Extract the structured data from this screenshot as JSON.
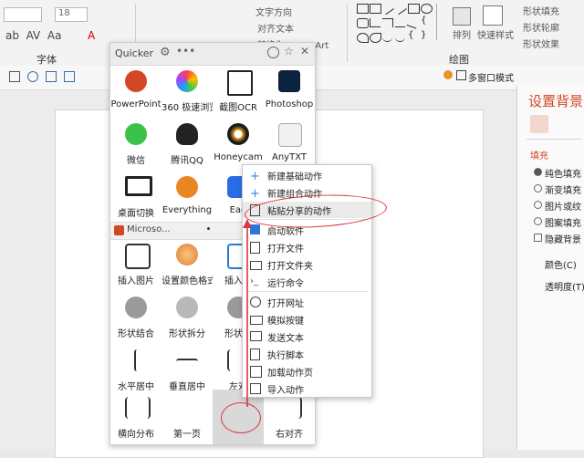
{
  "ribbon": {
    "font_size_value": "18",
    "group_font": "字体",
    "group_draw": "绘图",
    "text_direction": "文字方向",
    "align_text": "对齐文本",
    "convert_smartart": "转换为 SmartArt",
    "arrange": "排列",
    "quick_styles": "快速样式",
    "shape_fill": "形状填充",
    "shape_outline": "形状轮廓",
    "shape_effects": "形状效果"
  },
  "toolbar2": {
    "multi_window": "多窗口模式"
  },
  "right_panel": {
    "title": "设置背景",
    "fill_section": "填充",
    "options": [
      "纯色填充",
      "渐变填充",
      "图片或纹",
      "图案填充",
      "隐藏背景"
    ],
    "color_label": "颜色(C)",
    "transparency_label": "透明度(T)"
  },
  "quicker": {
    "title": "Quicker",
    "tiles_row1": [
      "PowerPoint",
      "360 极速浏览器X",
      "截图OCR",
      "Photoshop"
    ],
    "tiles_row2": [
      "微信",
      "腾讯QQ",
      "Honeycam",
      "AnyTXT"
    ],
    "tiles_row3": [
      "桌面切换",
      "Everything",
      "Eag"
    ],
    "section_title": "Microso...",
    "tiles_row4": [
      "插入图片",
      "设置颜色格式",
      "插入表"
    ],
    "tiles_row5": [
      "形状结合",
      "形状拆分",
      "形状相"
    ],
    "tiles_row6": [
      "水平居中",
      "垂直居中",
      "左对"
    ],
    "tiles_row7": [
      "横向分布",
      "第一页",
      "",
      "右对齐"
    ]
  },
  "context_menu": {
    "items": [
      "新建基础动作",
      "新建组合动作",
      "粘贴分享的动作",
      "启动软件",
      "打开文件",
      "打开文件夹",
      "运行命令",
      "打开网址",
      "模拟按键",
      "发送文本",
      "执行脚本",
      "加载动作页",
      "导入动作"
    ]
  },
  "colors": {
    "annotation_red": "#d9363e",
    "accent_orange": "#d24726",
    "panel_bg": "#ffffff"
  }
}
